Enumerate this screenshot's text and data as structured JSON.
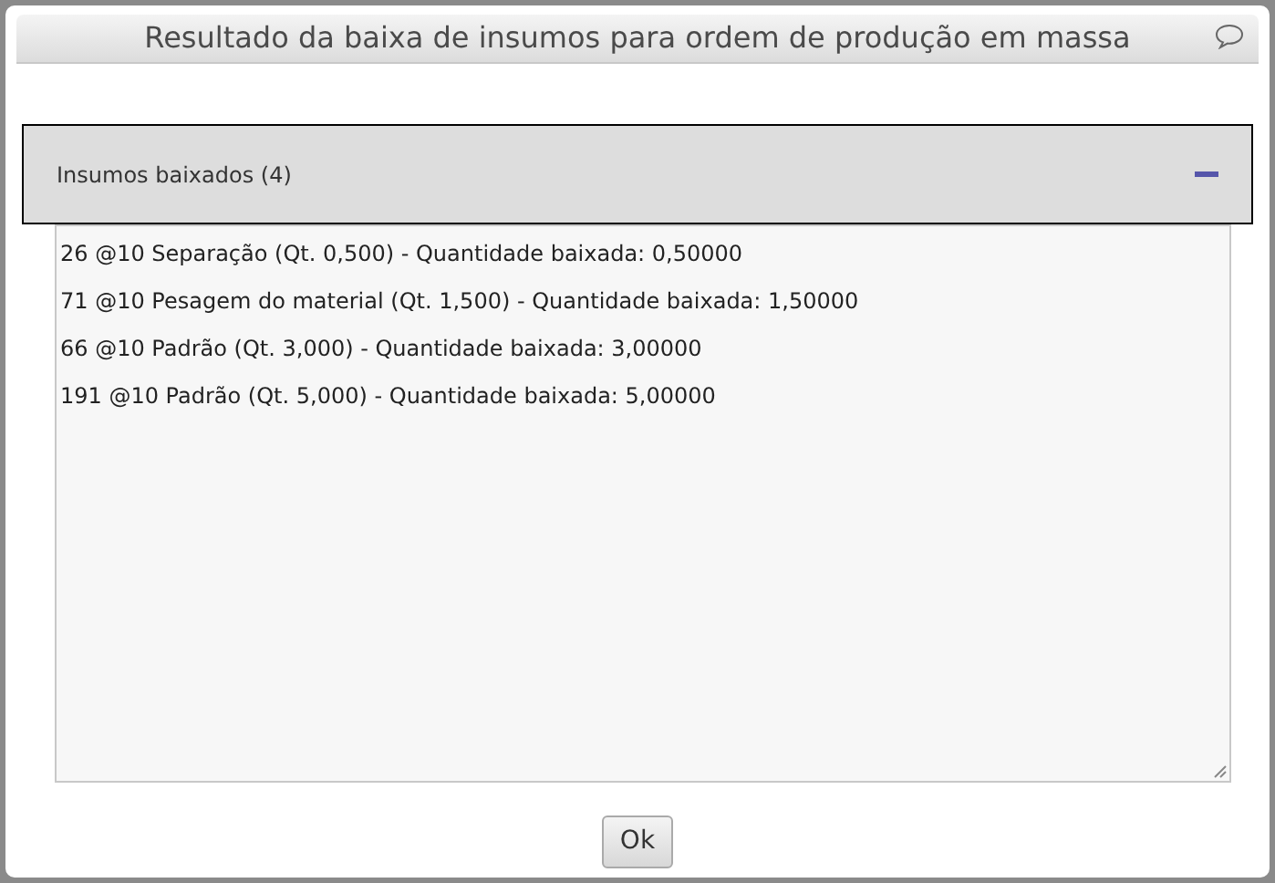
{
  "dialog": {
    "title": "Resultado da baixa de insumos para ordem de produção em massa"
  },
  "panel": {
    "title": "Insumos baixados (4)",
    "expanded": true,
    "lines": [
      "26 @10 Separação (Qt. 0,500) - Quantidade baixada: 0,50000",
      "71 @10 Pesagem do material (Qt. 1,500) - Quantidade baixada: 1,50000",
      "66 @10 Padrão (Qt. 3,000) - Quantidade baixada: 3,00000",
      "191 @10 Padrão (Qt. 5,000) - Quantidade baixada: 5,00000"
    ]
  },
  "buttons": [
    "Ok"
  ]
}
